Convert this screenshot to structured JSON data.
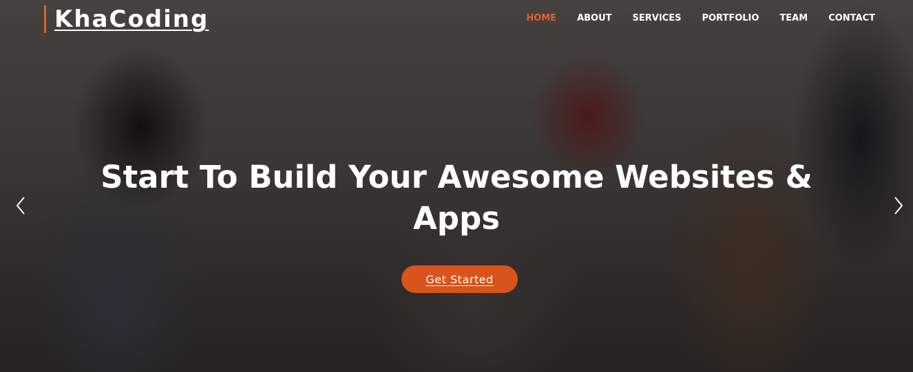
{
  "brand": {
    "name": "KhaCoding",
    "accent": "#e0622d"
  },
  "nav": {
    "items": [
      {
        "label": "HOME",
        "active": true
      },
      {
        "label": "ABOUT",
        "active": false
      },
      {
        "label": "SERVICES",
        "active": false
      },
      {
        "label": "PORTFOLIO",
        "active": false
      },
      {
        "label": "TEAM",
        "active": false
      },
      {
        "label": "CONTACT",
        "active": false
      }
    ]
  },
  "hero": {
    "headline_line1": "Start To Build Your Awesome Websites &",
    "headline_line2": "Apps",
    "cta_label": "Get Started",
    "cta_color": "#d9541c",
    "prev_icon": "chevron-left-icon",
    "next_icon": "chevron-right-icon"
  }
}
